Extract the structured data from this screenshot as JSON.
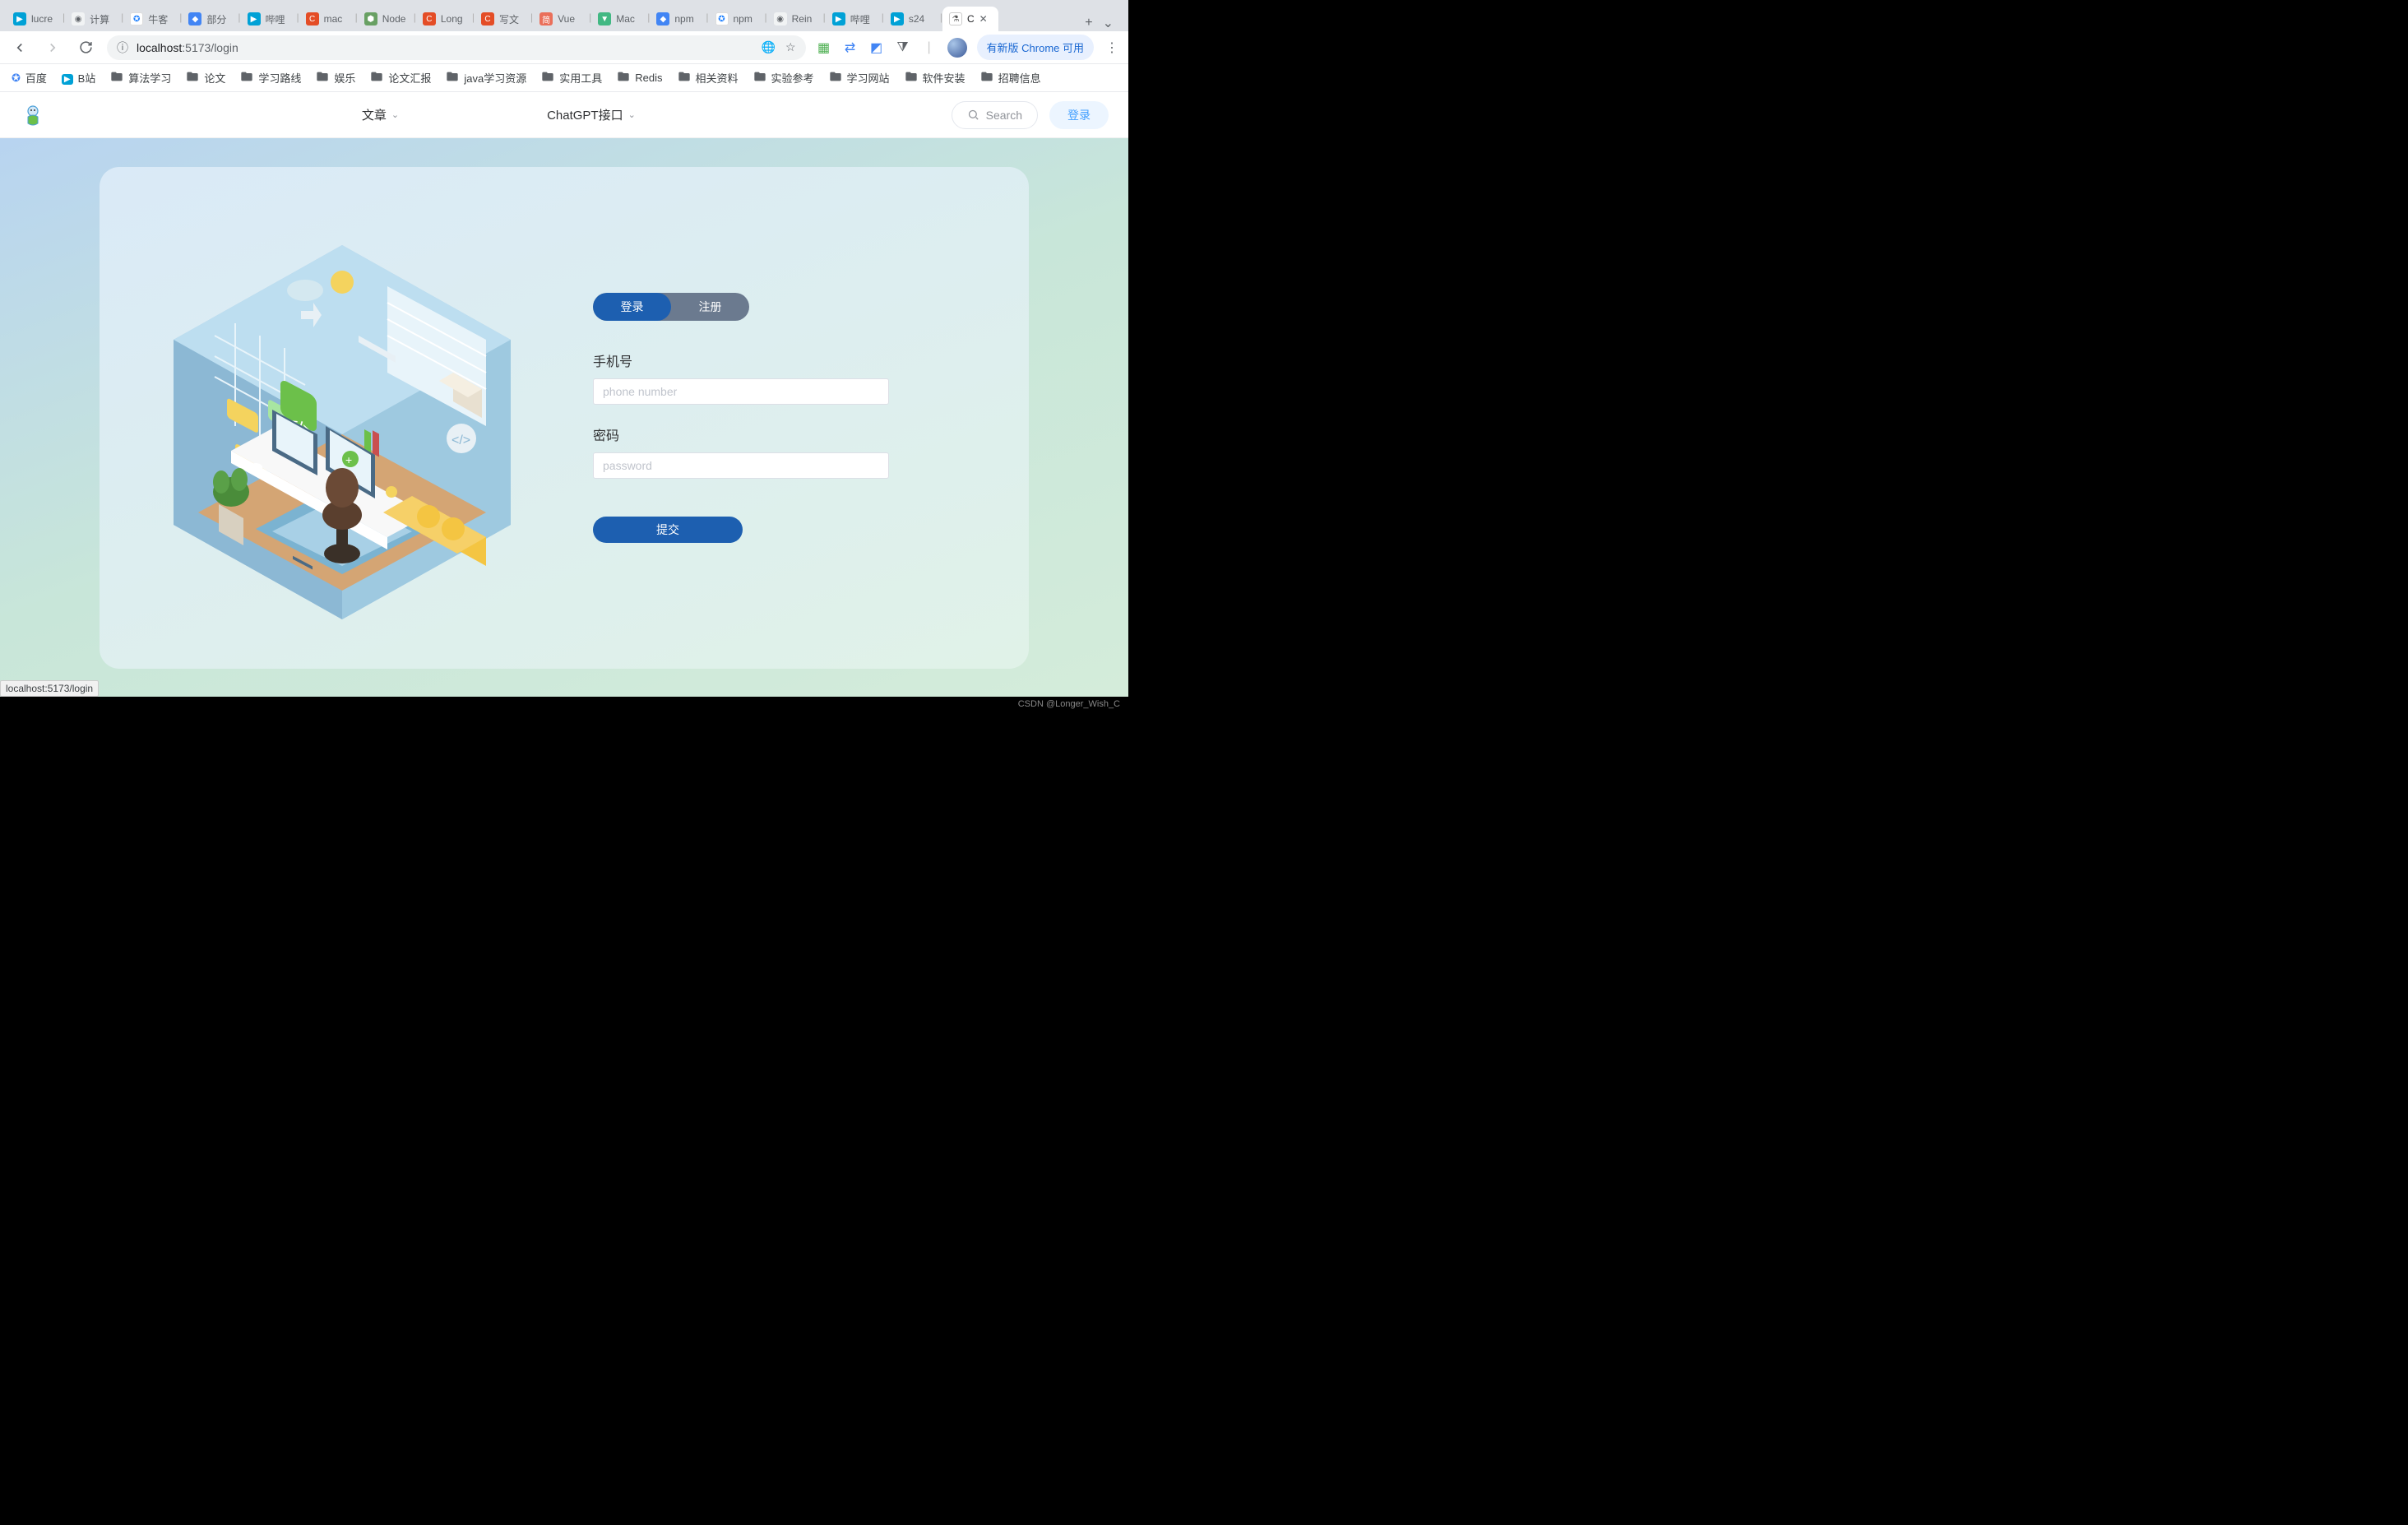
{
  "browser": {
    "tabs": [
      {
        "label": "lucre",
        "fav": "fav-bili"
      },
      {
        "label": "计算",
        "fav": "fav-globe"
      },
      {
        "label": "牛客",
        "fav": "fav-nk"
      },
      {
        "label": "部分",
        "fav": "fav-blue"
      },
      {
        "label": "哔哩",
        "fav": "fav-bili"
      },
      {
        "label": "mac",
        "fav": "fav-c"
      },
      {
        "label": "Node",
        "fav": "fav-node"
      },
      {
        "label": "Long",
        "fav": "fav-c"
      },
      {
        "label": "写文",
        "fav": "fav-c"
      },
      {
        "label": "Vue",
        "fav": "fav-jian"
      },
      {
        "label": "Mac",
        "fav": "fav-v"
      },
      {
        "label": "npm",
        "fav": "fav-blue"
      },
      {
        "label": "npm",
        "fav": "fav-nk"
      },
      {
        "label": "Rein",
        "fav": "fav-globe"
      },
      {
        "label": "哔哩",
        "fav": "fav-bili"
      },
      {
        "label": "s24",
        "fav": "fav-bili"
      },
      {
        "label": "C",
        "fav": "fav-flask",
        "active": true
      }
    ],
    "url_host": "localhost",
    "url_path": ":5173/login",
    "update_label": "有新版 Chrome 可用",
    "bookmarks": [
      {
        "label": "百度",
        "icon": "paw"
      },
      {
        "label": "B站",
        "icon": "bili"
      },
      {
        "label": "算法学习",
        "icon": "fold"
      },
      {
        "label": "论文",
        "icon": "fold"
      },
      {
        "label": "学习路线",
        "icon": "fold"
      },
      {
        "label": "娱乐",
        "icon": "fold"
      },
      {
        "label": "论文汇报",
        "icon": "fold"
      },
      {
        "label": "java学习资源",
        "icon": "fold"
      },
      {
        "label": "实用工具",
        "icon": "fold"
      },
      {
        "label": "Redis",
        "icon": "fold"
      },
      {
        "label": "相关资料",
        "icon": "fold"
      },
      {
        "label": "实验参考",
        "icon": "fold"
      },
      {
        "label": "学习网站",
        "icon": "fold"
      },
      {
        "label": "软件安装",
        "icon": "fold"
      },
      {
        "label": "招聘信息",
        "icon": "fold"
      }
    ],
    "status_text": "localhost:5173/login"
  },
  "page": {
    "nav": {
      "item1": "文章",
      "item2": "ChatGPT接口",
      "search_label": "Search",
      "login_label": "登录"
    },
    "form": {
      "tab_login": "登录",
      "tab_register": "注册",
      "phone_label": "手机号",
      "phone_placeholder": "phone number",
      "password_label": "密码",
      "password_placeholder": "password",
      "submit_label": "提交"
    }
  },
  "watermark": "CSDN @Longer_Wish_C"
}
